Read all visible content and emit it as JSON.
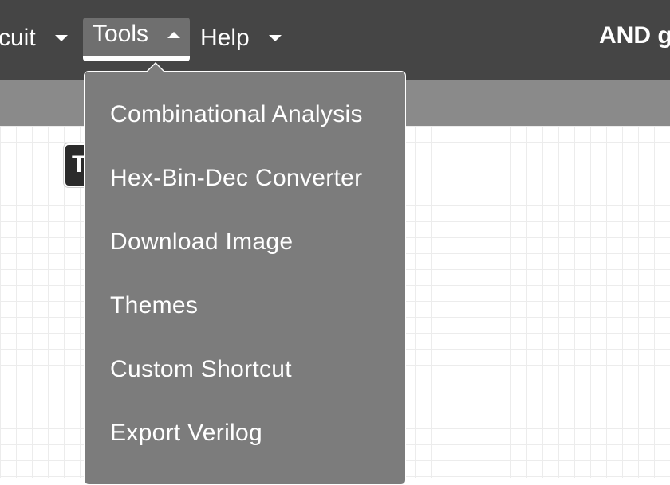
{
  "navbar": {
    "items": [
      {
        "label": "rcuit",
        "state": "collapsed"
      },
      {
        "label": "Tools",
        "state": "expanded"
      },
      {
        "label": "Help",
        "state": "collapsed"
      }
    ],
    "project_title": "AND g"
  },
  "tooltip": {
    "visible_text": "T"
  },
  "tools_menu": {
    "items": [
      {
        "label": "Combinational Analysis"
      },
      {
        "label": "Hex-Bin-Dec Converter"
      },
      {
        "label": "Download Image"
      },
      {
        "label": "Themes"
      },
      {
        "label": "Custom Shortcut"
      },
      {
        "label": "Export Verilog"
      }
    ]
  },
  "colors": {
    "navbar_bg": "#454545",
    "subbar_bg": "#8a8a8a",
    "dropdown_bg": "#7c7c7c",
    "active_tab_bg": "#6f6f6f",
    "text": "#ffffff"
  }
}
